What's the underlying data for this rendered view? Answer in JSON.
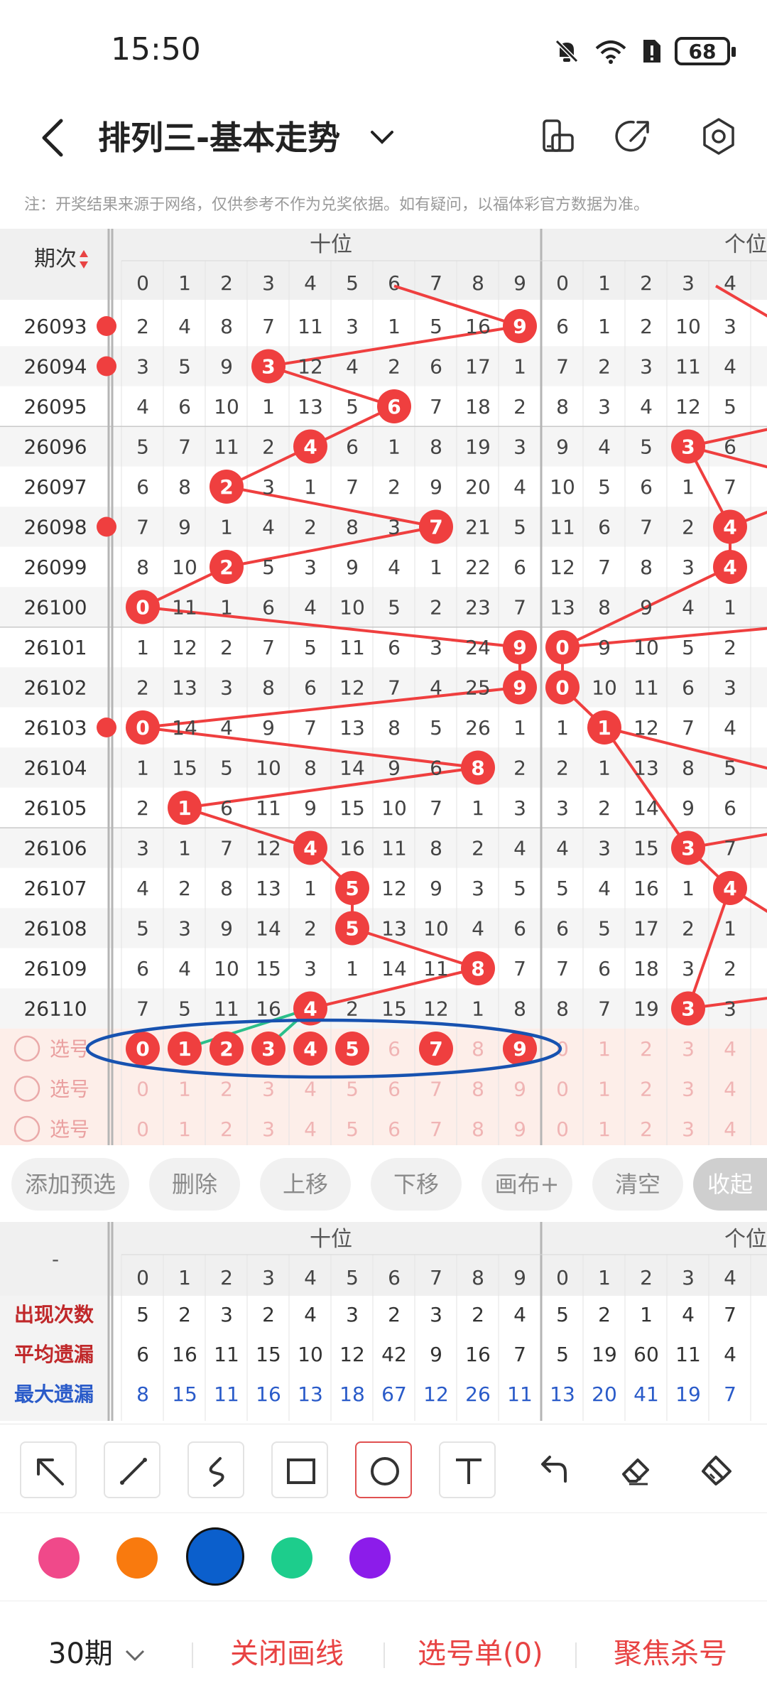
{
  "status_bar": {
    "time": "15:50",
    "battery": "68"
  },
  "header": {
    "title": "排列三-基本走势"
  },
  "note": "注：开奖结果来源于网络，仅供参考不作为兑奖依据。如有疑问，以福体彩官方数据为准。",
  "chart": {
    "period_header": "期次",
    "group_tens": "十位",
    "group_ones": "个位",
    "digits": [
      "0",
      "1",
      "2",
      "3",
      "4",
      "5",
      "6",
      "7",
      "8",
      "9"
    ],
    "ones_visible_digits": [
      "0",
      "1",
      "2",
      "3",
      "4"
    ],
    "rows": [
      {
        "period": "26093",
        "tens": [
          2,
          4,
          8,
          7,
          11,
          3,
          1,
          5,
          16,
          9
        ],
        "ones": [
          6,
          1,
          2,
          10,
          3
        ],
        "hit_tens": 9,
        "hit_ones": null
      },
      {
        "period": "26094",
        "tens": [
          3,
          5,
          9,
          3,
          12,
          4,
          2,
          6,
          17,
          1
        ],
        "ones": [
          7,
          2,
          3,
          11,
          4
        ],
        "hit_tens": 3,
        "hit_ones": null
      },
      {
        "period": "26095",
        "tens": [
          4,
          6,
          10,
          1,
          13,
          5,
          6,
          7,
          18,
          2
        ],
        "ones": [
          8,
          3,
          4,
          12,
          5
        ],
        "hit_tens": 6,
        "hit_ones": null
      },
      {
        "period": "26096",
        "tens": [
          5,
          7,
          11,
          2,
          4,
          6,
          1,
          8,
          19,
          3
        ],
        "ones": [
          9,
          4,
          5,
          3,
          6
        ],
        "hit_tens": 4,
        "hit_ones": 3
      },
      {
        "period": "26097",
        "tens": [
          6,
          8,
          2,
          3,
          1,
          7,
          2,
          9,
          20,
          4
        ],
        "ones": [
          10,
          5,
          6,
          1,
          7
        ],
        "hit_tens": 2,
        "hit_ones": null
      },
      {
        "period": "26098",
        "tens": [
          7,
          9,
          1,
          4,
          2,
          8,
          3,
          7,
          21,
          5
        ],
        "ones": [
          11,
          6,
          7,
          2,
          4
        ],
        "hit_tens": 7,
        "hit_ones": 4
      },
      {
        "period": "26099",
        "tens": [
          8,
          10,
          2,
          5,
          3,
          9,
          4,
          1,
          22,
          6
        ],
        "ones": [
          12,
          7,
          8,
          3,
          4
        ],
        "hit_tens": 2,
        "hit_ones": 4
      },
      {
        "period": "26100",
        "tens": [
          0,
          11,
          1,
          6,
          4,
          10,
          5,
          2,
          23,
          7
        ],
        "ones": [
          13,
          8,
          9,
          4,
          1
        ],
        "hit_tens": 0,
        "hit_ones": null
      },
      {
        "period": "26101",
        "tens": [
          1,
          12,
          2,
          7,
          5,
          11,
          6,
          3,
          24,
          9
        ],
        "ones": [
          0,
          9,
          10,
          5,
          2
        ],
        "hit_tens": 9,
        "hit_ones": 0
      },
      {
        "period": "26102",
        "tens": [
          2,
          13,
          3,
          8,
          6,
          12,
          7,
          4,
          25,
          9
        ],
        "ones": [
          0,
          10,
          11,
          6,
          3
        ],
        "hit_tens": 9,
        "hit_ones": 0
      },
      {
        "period": "26103",
        "tens": [
          0,
          14,
          4,
          9,
          7,
          13,
          8,
          5,
          26,
          1
        ],
        "ones": [
          1,
          1,
          12,
          7,
          4
        ],
        "hit_tens": 0,
        "hit_ones": 1
      },
      {
        "period": "26104",
        "tens": [
          1,
          15,
          5,
          10,
          8,
          14,
          9,
          6,
          8,
          2
        ],
        "ones": [
          2,
          1,
          13,
          8,
          5
        ],
        "hit_tens": 8,
        "hit_ones": null
      },
      {
        "period": "26105",
        "tens": [
          2,
          1,
          6,
          11,
          9,
          15,
          10,
          7,
          1,
          3
        ],
        "ones": [
          3,
          2,
          14,
          9,
          6
        ],
        "hit_tens": 1,
        "hit_ones": null
      },
      {
        "period": "26106",
        "tens": [
          3,
          1,
          7,
          12,
          4,
          16,
          11,
          8,
          2,
          4
        ],
        "ones": [
          4,
          3,
          15,
          3,
          7
        ],
        "hit_tens": 4,
        "hit_ones": 3
      },
      {
        "period": "26107",
        "tens": [
          4,
          2,
          8,
          13,
          1,
          5,
          12,
          9,
          3,
          5
        ],
        "ones": [
          5,
          4,
          16,
          1,
          4
        ],
        "hit_tens": 5,
        "hit_ones": 4
      },
      {
        "period": "26108",
        "tens": [
          5,
          3,
          9,
          14,
          2,
          5,
          13,
          10,
          4,
          6
        ],
        "ones": [
          6,
          5,
          17,
          2,
          1
        ],
        "hit_tens": 5,
        "hit_ones": null
      },
      {
        "period": "26109",
        "tens": [
          6,
          4,
          10,
          15,
          3,
          1,
          14,
          11,
          8,
          7
        ],
        "ones": [
          7,
          6,
          18,
          3,
          2
        ],
        "hit_tens": 8,
        "hit_ones": null
      },
      {
        "period": "26110",
        "tens": [
          7,
          5,
          11,
          16,
          4,
          2,
          15,
          12,
          1,
          8
        ],
        "ones": [
          8,
          7,
          19,
          3,
          3
        ],
        "hit_tens": 4,
        "hit_ones": 3
      }
    ],
    "select_label": "选号",
    "select_rows": [
      {
        "selected": [
          0,
          1,
          2,
          3,
          4,
          5,
          7,
          9
        ]
      },
      {
        "selected": []
      },
      {
        "selected": []
      }
    ]
  },
  "actions": [
    {
      "label": "添加预选"
    },
    {
      "label": "删除"
    },
    {
      "label": "上移"
    },
    {
      "label": "下移"
    },
    {
      "label": "画布+"
    },
    {
      "label": "清空"
    },
    {
      "label": "收起"
    }
  ],
  "stats": {
    "corner": "-",
    "group_tens": "十位",
    "group_ones": "个位",
    "rows": [
      {
        "label": "出现次数",
        "tens": [
          5,
          2,
          3,
          2,
          4,
          3,
          2,
          3,
          2,
          4
        ],
        "ones": [
          5,
          2,
          1,
          4,
          7
        ],
        "color": "#333333"
      },
      {
        "label": "平均遗漏",
        "tens": [
          6,
          16,
          11,
          15,
          10,
          12,
          42,
          9,
          16,
          7
        ],
        "ones": [
          5,
          19,
          60,
          11,
          4
        ],
        "color": "#333333"
      },
      {
        "label": "最大遗漏",
        "tens": [
          8,
          15,
          11,
          16,
          13,
          18,
          67,
          12,
          26,
          11
        ],
        "ones": [
          13,
          20,
          41,
          19,
          7
        ],
        "color": "#2a5bc9"
      }
    ]
  },
  "tools": [
    "arrow-icon",
    "line-icon",
    "curve-icon",
    "rect-icon",
    "circle-icon",
    "text-icon",
    "undo-icon",
    "eraser-icon",
    "clear-brush-icon"
  ],
  "palette": [
    "#f0498a",
    "#f97a0e",
    "#0b5fcc",
    "#1dcd8c",
    "#8c1cea"
  ],
  "selected_color": "#0b5fcc",
  "bottom": {
    "period_select": "30期",
    "close_drawing": "关闭画线",
    "pick_list": "选号单(0)",
    "focus_kill": "聚焦杀号"
  },
  "colors": {
    "accent": "#e84343",
    "ball": "#ef3f3f",
    "annotation": "#1752b0",
    "green_line": "#2bbf8a"
  }
}
